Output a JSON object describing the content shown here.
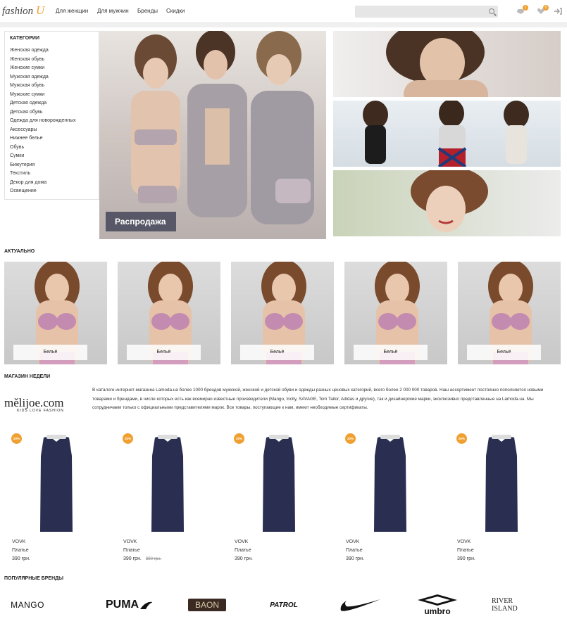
{
  "header": {
    "logo_text": "fashion",
    "logo_accent": "U",
    "nav": [
      "Для женщин",
      "Для мужчин",
      "Бренды",
      "Скидки"
    ],
    "search_placeholder": "",
    "wishlist_count": "1",
    "cart_count": "0"
  },
  "categories": {
    "title": "КАТЕГОРИИ",
    "items": [
      "Женская одежда",
      "Женская обувь",
      "Женские сумки",
      "Мужская одежда",
      "Мужская обувь",
      "Мужские сумки",
      "Детская одежда",
      "Детская обувь",
      "Одежда для новорожденных",
      "Аксессуары",
      "Нижнее белье",
      "Обувь",
      "Сумки",
      "Бижутерия",
      "Текстиль",
      "Декор для дома",
      "Освещение"
    ]
  },
  "hero": {
    "sale_label": "Распродажа"
  },
  "actual": {
    "title": "АКТУАЛЬНО",
    "items": [
      "Бельё",
      "Бельё",
      "Бельё",
      "Бельё",
      "Бельё"
    ]
  },
  "shop_of_week": {
    "title": "МАГАЗИН НЕДЕЛИ",
    "logo": "mělijoe.com",
    "logo_tagline": "KIDS LOVE FASHION",
    "description": "В каталоге интернет-магазина Lamoda.ua более 1000 брендов мужской, женской и детской обуви и одежды разных ценовых категорий, всего более 2 000 000 товаров. Наш ассортимент постоянно пополняется новыми товарами и брендами, в числе которых есть как всемирно известные производители (Mango, Incity, SAVAGE, Tom Tailor, Adidas и другие), так и дизайнерские марки, эксклюзивно представленные на Lamoda.ua. Мы сотрудничаем только с официальными представителями марок. Все товары, поступающие к нам, имеют необходимые сертификаты."
  },
  "products": [
    {
      "discount": "20%",
      "brand": "VOVK",
      "name": "Платье",
      "price": "390 грн.",
      "old_price": ""
    },
    {
      "discount": "20%",
      "brand": "VOVK",
      "name": "Платье",
      "price": "390 грн.",
      "old_price": "390 грн."
    },
    {
      "discount": "20%",
      "brand": "VOVK",
      "name": "Платье",
      "price": "390 грн.",
      "old_price": ""
    },
    {
      "discount": "20%",
      "brand": "VOVK",
      "name": "Платье",
      "price": "390 грн.",
      "old_price": ""
    },
    {
      "discount": "20%",
      "brand": "VOVK",
      "name": "Платье",
      "price": "390 грн.",
      "old_price": ""
    }
  ],
  "brands": {
    "title": "ПОПУЛЯРНЫЕ БРЕНДЫ",
    "items": [
      "MANGO",
      "PUMA",
      "BAON",
      "PATROL",
      "NIKE",
      "umbro",
      "RIVER ISLAND"
    ]
  },
  "colors": {
    "accent": "#f0a030",
    "dress": "#2a2f52"
  }
}
